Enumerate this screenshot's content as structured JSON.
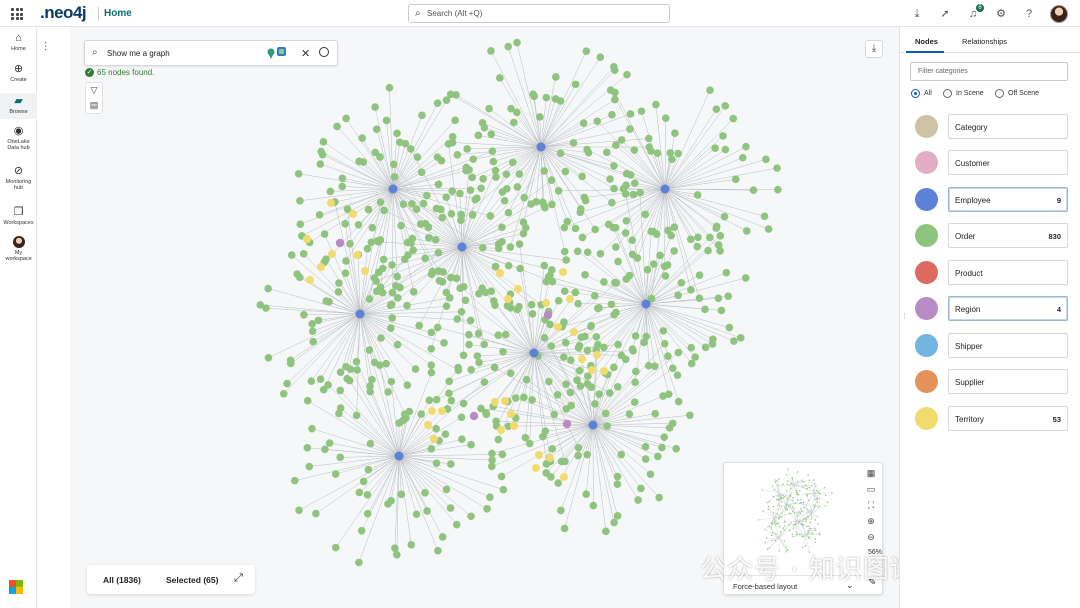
{
  "topbar": {
    "logo": ".neo4j",
    "home_label": "Home",
    "search_placeholder": "Search (Alt +Q)",
    "notifications_count": "6",
    "icons": [
      "download-icon",
      "rocket-icon",
      "bell-icon",
      "gear-icon",
      "help-icon",
      "avatar"
    ]
  },
  "leftnav": {
    "items": [
      {
        "label": "Home",
        "icon": "home-icon"
      },
      {
        "label": "Create",
        "icon": "plus-circle-icon"
      },
      {
        "label": "Browse",
        "icon": "folder-icon",
        "active": true
      },
      {
        "label": "OneLake Data hub",
        "icon": "onelake-icon"
      },
      {
        "label": "Monitoring hub",
        "icon": "monitor-icon"
      },
      {
        "label": "Workspaces",
        "icon": "workspaces-icon"
      },
      {
        "label": "My workspace",
        "icon": "user-avatar-icon"
      }
    ]
  },
  "canvas": {
    "nl_query": "Show me a graph",
    "found_text": "65 nodes found.",
    "all_label": "All (1836)",
    "selected_label": "Selected (65)",
    "layout_label": "Force-based layout",
    "zoom_label": "56%"
  },
  "panel": {
    "tabs": [
      "Nodes",
      "Relationships"
    ],
    "filter_placeholder": "Filter categories",
    "radio_options": [
      "All",
      "In Scene",
      "Off Scene"
    ],
    "categories": [
      {
        "name": "Category",
        "color": "#cfc2a4",
        "count": ""
      },
      {
        "name": "Customer",
        "color": "#e3adc6",
        "count": ""
      },
      {
        "name": "Employee",
        "color": "#5b82d6",
        "count": "9"
      },
      {
        "name": "Order",
        "color": "#8fc47f",
        "count": "830"
      },
      {
        "name": "Product",
        "color": "#dd6a5f",
        "count": ""
      },
      {
        "name": "Region",
        "color": "#b98bc4",
        "count": "4"
      },
      {
        "name": "Shipper",
        "color": "#72b5e0",
        "count": ""
      },
      {
        "name": "Supplier",
        "color": "#e4915a",
        "count": ""
      },
      {
        "name": "Territory",
        "color": "#f2db6e",
        "count": "53"
      }
    ]
  },
  "watermark": "公众号 · 知识图谱科技"
}
